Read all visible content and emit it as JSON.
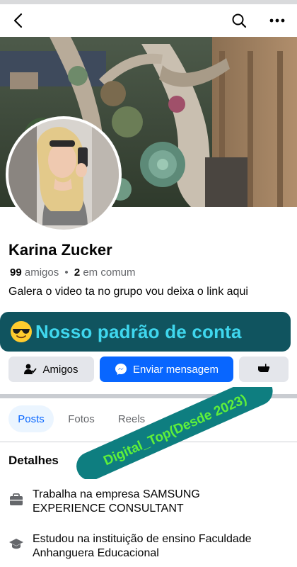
{
  "header": {
    "back_icon": "arrow-left-icon",
    "search_icon": "search-icon",
    "more_icon": "more-dots-icon"
  },
  "profile": {
    "name": "Karina Zucker",
    "friends_count": "99",
    "friends_label": "amigos",
    "separator": "•",
    "mutual_count": "2",
    "mutual_label": "em comum",
    "bio": "Galera o video ta no grupo vou deixa o link aqui"
  },
  "banner": {
    "text": "Nosso padrão de conta",
    "emoji_icon": "sunglasses-face-icon",
    "bg_color": "#10545f",
    "text_color": "#3fd7ee"
  },
  "actions": {
    "friends_label": "Amigos",
    "message_label": "Enviar mensagem",
    "more_icon": "hand-pointing-icon",
    "accent": "#0866ff"
  },
  "tabs": [
    {
      "label": "Posts"
    },
    {
      "label": "Fotos"
    },
    {
      "label": "Reels"
    }
  ],
  "watermark": {
    "text": "Digital_Top(Desde 2023)",
    "color": "#0e7e80"
  },
  "details": {
    "title": "Detalhes",
    "items": [
      {
        "icon": "briefcase-icon",
        "text": "Trabalha na empresa SAMSUNG EXPERIENCE CONSULTANT"
      },
      {
        "icon": "graduation-cap-icon",
        "text": "Estudou na instituição de ensino Faculdade Anhanguera Educacional"
      }
    ]
  }
}
